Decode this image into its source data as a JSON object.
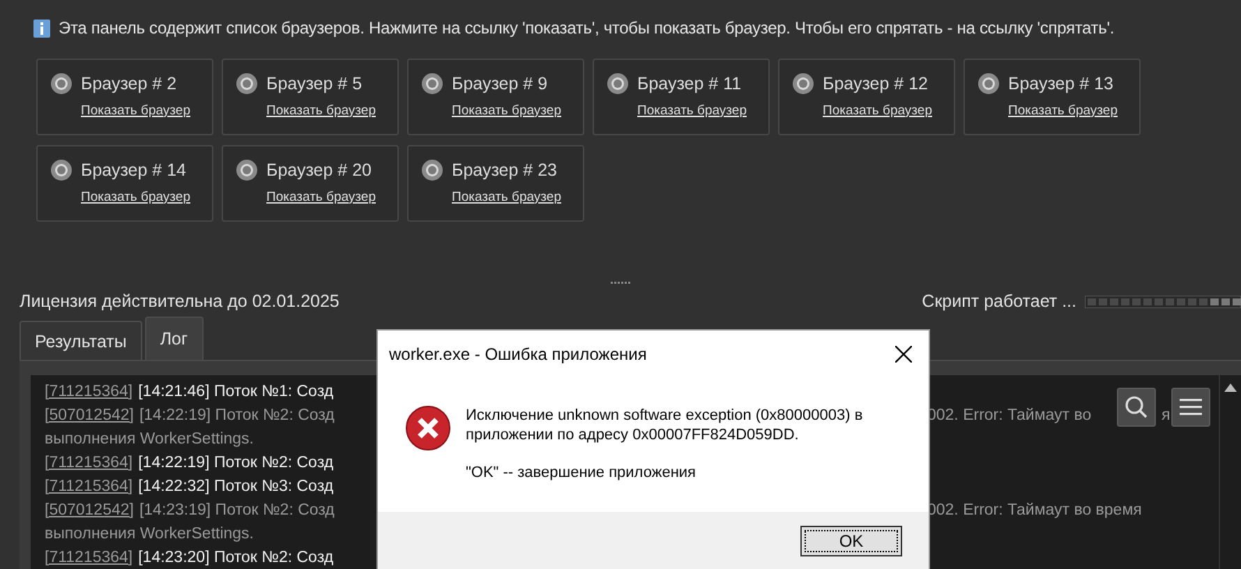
{
  "info": "Эта панель содержит список браузеров. Нажмите на ссылку 'показать', чтобы показать браузер. Чтобы его спрятать - на ссылку 'спрятать'.",
  "browsers": [
    {
      "name": "Браузер # 2",
      "link": "Показать браузер"
    },
    {
      "name": "Браузер # 5",
      "link": "Показать браузер"
    },
    {
      "name": "Браузер # 9",
      "link": "Показать браузер"
    },
    {
      "name": "Браузер # 11",
      "link": "Показать браузер"
    },
    {
      "name": "Браузер # 12",
      "link": "Показать браузер"
    },
    {
      "name": "Браузер # 13",
      "link": "Показать браузер"
    },
    {
      "name": "Браузер # 14",
      "link": "Показать браузер"
    },
    {
      "name": "Браузер # 20",
      "link": "Показать браузер"
    },
    {
      "name": "Браузер # 23",
      "link": "Показать браузер"
    }
  ],
  "status": {
    "license": "Лицензия действительна до 02.01.2025",
    "script": "Скрипт работает ..."
  },
  "tabs": [
    {
      "label": "Результаты",
      "selected": false
    },
    {
      "label": "Лог",
      "selected": true
    }
  ],
  "log": [
    {
      "kind": "info",
      "id": "[711215364]",
      "text": "[14:21:46] Поток №1: Созд"
    },
    {
      "kind": "error",
      "id": "[507012542]",
      "text": "[14:22:19] Поток №2: Созд",
      "tail": "002. Error: Таймаут во",
      "tail_end": "я"
    },
    {
      "kind": "error",
      "text": "выполнения WorkerSettings."
    },
    {
      "kind": "info",
      "id": "[711215364]",
      "text": "[14:22:19] Поток №2: Созд"
    },
    {
      "kind": "info",
      "id": "[711215364]",
      "text": "[14:22:32] Поток №3: Созд"
    },
    {
      "kind": "error",
      "id": "[507012542]",
      "text": "[14:23:19] Поток №2: Созд",
      "tail": "002. Error: Таймаут во время"
    },
    {
      "kind": "error",
      "text": "выполнения WorkerSettings."
    },
    {
      "kind": "info",
      "id": "[711215364]",
      "text": "[14:23:20] Поток №2: Созд"
    }
  ],
  "dialog": {
    "title": "worker.exe - Ошибка приложения",
    "message": "Исключение unknown software exception (0x80000003) в приложении по адресу 0x00007FF824D059DD.",
    "note": "\"OK\" -- завершение приложения",
    "button": "OK"
  }
}
